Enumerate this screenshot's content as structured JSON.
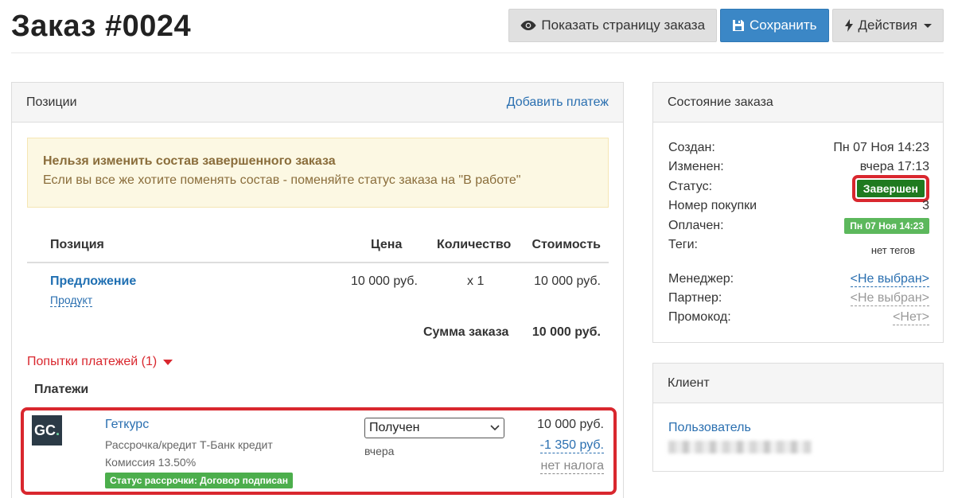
{
  "header": {
    "title": "Заказ #0024",
    "buttons": {
      "show_page": "Показать страницу заказа",
      "save": "Сохранить",
      "actions": "Действия"
    }
  },
  "positions_panel": {
    "heading": "Позиции",
    "add_payment": "Добавить платеж",
    "alert": {
      "title": "Нельзя изменить состав завершенного заказа",
      "text": "Если вы все же хотите поменять состав - поменяйте статус заказа на \"В работе\""
    },
    "table": {
      "columns": [
        "Позиция",
        "Цена",
        "Количество",
        "Стоимость"
      ],
      "item": {
        "title": "Предложение",
        "type": "Продукт",
        "price": "10 000 руб.",
        "quantity": "x 1",
        "cost": "10 000 руб."
      },
      "sum_label": "Сумма заказа",
      "sum_value": "10 000 руб."
    },
    "attempts_label": "Попытки платежей (1)",
    "payments_title": "Платежи",
    "payment": {
      "logo_text": "GC",
      "logo_dot": ".",
      "name": "Геткурс",
      "method": "Рассрочка/кредит Т-Банк кредит",
      "commission": "Комиссия 13.50%",
      "badge": "Статус рассрочки: Договор подписан",
      "status_value": "Получен",
      "when": "вчера",
      "amount": "10 000 руб.",
      "fee": "-1 350 руб.",
      "tax": "нет налога"
    }
  },
  "state_panel": {
    "heading": "Состояние заказа",
    "created_label": "Создан:",
    "created_value": "Пн 07 Ноя 14:23",
    "changed_label": "Изменен:",
    "changed_value": "вчера 17:13",
    "status_label": "Статус:",
    "status_value": "Завершен",
    "purchase_label": "Номер покупки",
    "purchase_value": "3",
    "paid_label": "Оплачен:",
    "paid_value": "Пн 07 Ноя 14:23",
    "tags_label": "Теги:",
    "tags_value": "нет тегов",
    "manager_label": "Менеджер:",
    "manager_value": "<Не выбран>",
    "partner_label": "Партнер:",
    "partner_value": "<Не выбран>",
    "promo_label": "Промокод:",
    "promo_value": "<Нет>"
  },
  "client_panel": {
    "heading": "Клиент",
    "user_label": "Пользователь"
  },
  "colors": {
    "primary": "#3b87c6",
    "danger_outline": "#d9272e",
    "status_green": "#1f7a1f",
    "success": "#5cb85c",
    "alert_bg": "#fcf8e3"
  }
}
